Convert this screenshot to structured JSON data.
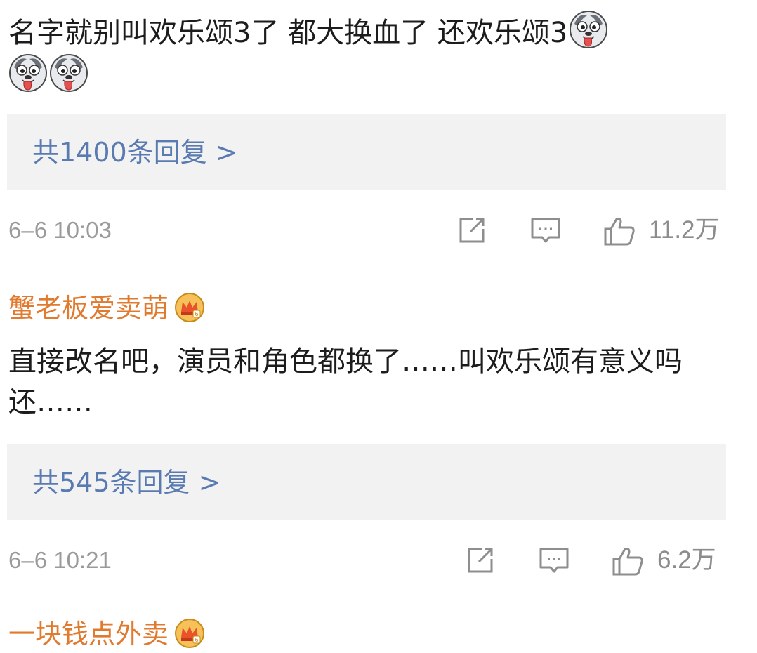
{
  "comments": [
    {
      "text": "名字就别叫欢乐颂3了 都大换血了 还欢乐颂3",
      "emojis": [
        "husky-tongue-icon",
        "husky-tongue-icon",
        "husky-tongue-icon"
      ],
      "replies_link": "共1400条回复 >",
      "time": "6–6 10:03",
      "likes": "11.2万"
    },
    {
      "username": "蟹老板爱卖萌",
      "badge": "vip-crown-icon",
      "text": "直接改名吧，演员和角色都换了……叫欢乐颂有意义吗还……",
      "replies_link": "共545条回复 >",
      "time": "6–6 10:21",
      "likes": "6.2万"
    },
    {
      "username": "一块钱点外卖",
      "badge": "vip-crown-icon"
    }
  ],
  "colors": {
    "username": "#e07a2e",
    "link": "#5a7bb1",
    "meta": "#9a9a9a",
    "reply_box_bg": "#f2f2f2",
    "text": "#1c1c1c"
  }
}
